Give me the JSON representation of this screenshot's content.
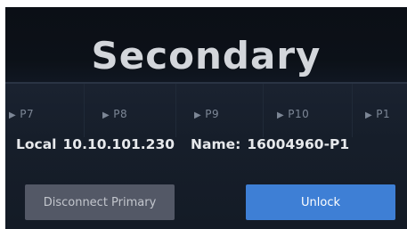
{
  "dialog": {
    "title": "Secondary"
  },
  "ports": [
    {
      "label": "P7"
    },
    {
      "label": "P8"
    },
    {
      "label": "P9"
    },
    {
      "label": "P10"
    },
    {
      "label": "P1"
    }
  ],
  "info": {
    "local_label": "Local",
    "local_ip": "10.10.101.230",
    "name_label": "Name:",
    "name_value": "16004960-P1"
  },
  "buttons": {
    "disconnect_label": "Disconnect Primary",
    "unlock_label": "Unlock"
  },
  "icons": {
    "port_marker": "play-triangle-icon"
  },
  "colors": {
    "accent": "#3e7fd5",
    "background": "#151b26",
    "secondary_button": "#535866"
  }
}
